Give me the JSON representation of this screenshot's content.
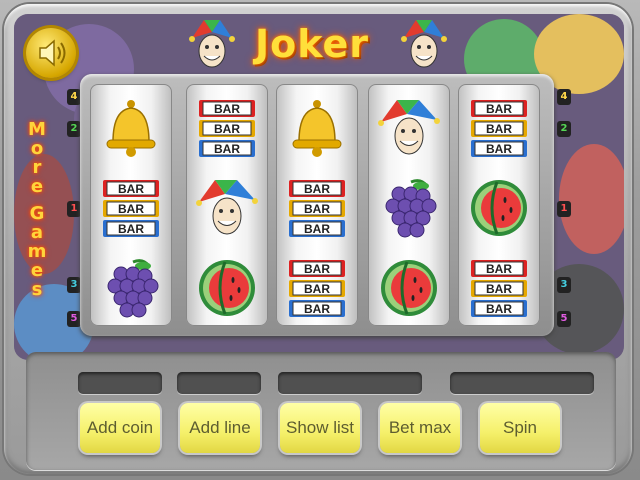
{
  "header": {
    "title": "Joker"
  },
  "side_link": {
    "letters": [
      "M",
      "o",
      "r",
      "e",
      "",
      "G",
      "a",
      "m",
      "e",
      "s"
    ]
  },
  "line_badges": {
    "left": [
      {
        "label": "4",
        "color": "#ffd84a"
      },
      {
        "label": "2",
        "color": "#55d655"
      },
      {
        "label": "1",
        "color": "#ff5050"
      },
      {
        "label": "3",
        "color": "#45cfe0"
      },
      {
        "label": "5",
        "color": "#e05ce0"
      }
    ],
    "right": [
      {
        "label": "4",
        "color": "#ffd84a"
      },
      {
        "label": "2",
        "color": "#55d655"
      },
      {
        "label": "1",
        "color": "#ff5050"
      },
      {
        "label": "3",
        "color": "#45cfe0"
      },
      {
        "label": "5",
        "color": "#e05ce0"
      }
    ]
  },
  "reels": [
    [
      "bell-icon",
      "bar-icon",
      "grapes-icon"
    ],
    [
      "bar-icon",
      "joker-icon",
      "watermelon-icon"
    ],
    [
      "bell-icon",
      "bar-icon",
      "bar-icon"
    ],
    [
      "joker-icon",
      "grapes-icon",
      "watermelon-icon"
    ],
    [
      "bar-icon",
      "watermelon-icon",
      "bar-icon"
    ]
  ],
  "bar_label": "BAR",
  "buttons": {
    "add_coin": "Add coin",
    "add_line": "Add line",
    "show_list": "Show list",
    "bet_max": "Bet max",
    "spin": "Spin"
  },
  "colors": {
    "title": "#ffdf3a",
    "button": "#f5f06a",
    "display": "#505050"
  }
}
